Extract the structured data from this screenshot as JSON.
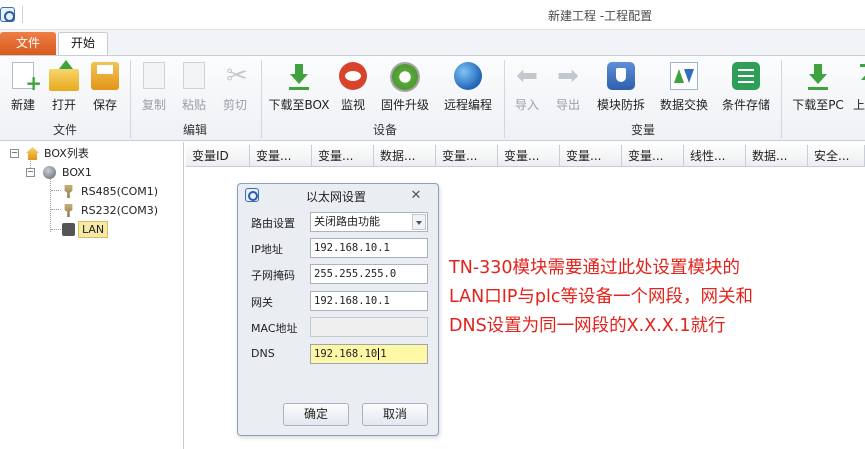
{
  "window": {
    "title": "新建工程 -工程配置"
  },
  "tabs": {
    "file": "文件",
    "home": "开始"
  },
  "ribbon": {
    "groups": {
      "file": "文件",
      "edit": "编辑",
      "device": "设备",
      "variable": "变量"
    },
    "buttons": {
      "new": "新建",
      "open": "打开",
      "save": "保存",
      "copy": "复制",
      "paste": "粘贴",
      "cut": "剪切",
      "download_box": "下载至BOX",
      "monitor": "监视",
      "firmware": "固件升级",
      "remote": "远程编程",
      "import": "导入",
      "export": "导出",
      "protect": "模块防拆",
      "exchange": "数据交换",
      "cond_store": "条件存储",
      "download_pc": "下载至PC",
      "upload": "上"
    }
  },
  "tree": {
    "root": "BOX列表",
    "box": "BOX1",
    "ports": [
      "RS485(COM1)",
      "RS232(COM3)",
      "LAN"
    ]
  },
  "grid": {
    "columns": [
      "变量ID",
      "变量...",
      "变量...",
      "数据...",
      "变量...",
      "变量...",
      "变量...",
      "变量...",
      "线性...",
      "数据...",
      "安全..."
    ]
  },
  "dialog": {
    "title": "以太网设置",
    "labels": {
      "route": "路由设置",
      "ip": "IP地址",
      "mask": "子网掩码",
      "gateway": "网关",
      "mac": "MAC地址",
      "dns": "DNS"
    },
    "values": {
      "route": "关闭路由功能",
      "ip": "192.168.10.1",
      "mask": "255.255.255.0",
      "gateway": "192.168.10.1",
      "mac": "",
      "dns_before_caret": "192.168.10",
      "dns_after_caret": "1"
    },
    "ok": "确定",
    "cancel": "取消"
  },
  "annotation": {
    "line1": "TN-330模块需要通过此处设置模块的",
    "line2": "LAN口IP与plc等设备一个网段，网关和",
    "line3": "DNS设置为同一网段的X.X.X.1就行",
    "color": "#e3231b"
  }
}
